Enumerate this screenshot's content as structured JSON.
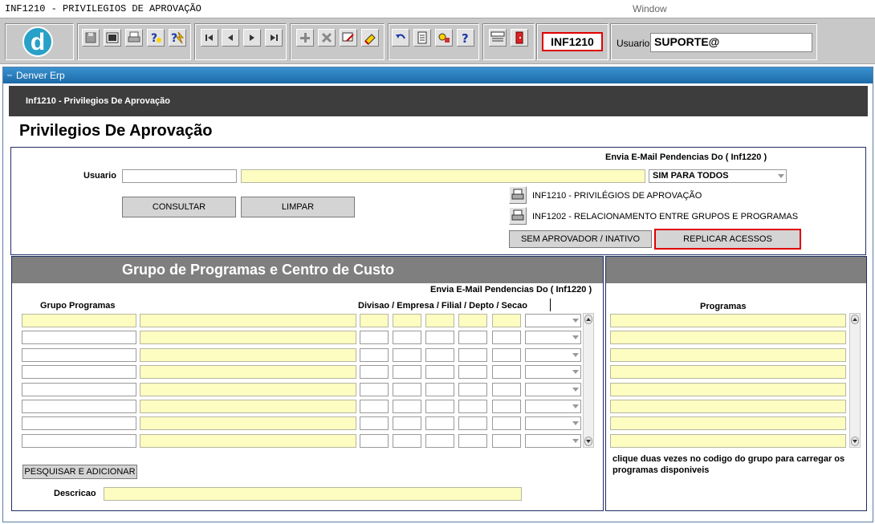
{
  "window": {
    "title": "INF1210 - PRIVILEGIOS DE APROVAÇÃO",
    "menu": "Window"
  },
  "toolbar": {
    "logo": "d",
    "program_code": "INF1210",
    "user_label": "Usuario",
    "user_value": "SUPORTE@",
    "icons": [
      "save-icon",
      "clear-form-icon",
      "print-icon",
      "query-icon",
      "execute-query-icon",
      "first-record-icon",
      "previous-record-icon",
      "next-record-icon",
      "last-record-icon",
      "insert-record-icon",
      "delete-record-icon",
      "edit-icon",
      "clear-record-icon",
      "undo-icon",
      "list-icon",
      "tools-icon",
      "help-icon",
      "menu-icon",
      "exit-icon"
    ]
  },
  "frame": {
    "title": "Denver Erp",
    "module": "Inf1210 - Privilegios De Aprovação",
    "page_title": "Privilegios De Aprovação"
  },
  "header_panel": {
    "email_label": "Envia E-Mail Pendencias Do ( Inf1220 )",
    "usuario_label": "Usuario",
    "usuario_code": "",
    "usuario_name": "",
    "email_select": "SIM PARA TODOS",
    "consultar": "CONSULTAR",
    "limpar": "LIMPAR",
    "report1": "INF1210 - PRIVILÉGIOS DE APROVAÇÃO",
    "report2": "INF1202 - RELACIONAMENTO ENTRE GRUPOS E PROGRAMAS",
    "sem_aprovador": "SEM APROVADOR / INATIVO",
    "replicar": "REPLICAR ACESSOS"
  },
  "grupo_panel": {
    "title": "Grupo de Programas e Centro de Custo",
    "email_label": "Envia E-Mail Pendencias Do ( Inf1220 )",
    "col_grupo": "Grupo Programas",
    "col_divisao": "Divisao / Empresa / Filial / Depto / Secao",
    "pesquisar": "PESQUISAR E ADICIONAR",
    "descricao_label": "Descricao",
    "descricao_value": ""
  },
  "programas_panel": {
    "header": "",
    "col_programas": "Programas",
    "hint": "clique duas vezes no codigo do grupo para carregar os programas disponiveis"
  }
}
